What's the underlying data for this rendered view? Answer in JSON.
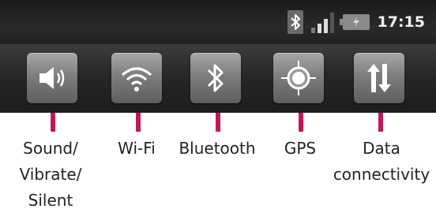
{
  "status_bar": {
    "time": "17:15",
    "icons": [
      "bluetooth-status-icon",
      "signal-strength-icon",
      "battery-icon"
    ]
  },
  "quick_settings": {
    "toggles": [
      {
        "id": "sound",
        "icon": "speaker-icon"
      },
      {
        "id": "wifi",
        "icon": "wifi-icon"
      },
      {
        "id": "bluetooth",
        "icon": "bluetooth-icon"
      },
      {
        "id": "gps",
        "icon": "gps-icon"
      },
      {
        "id": "data",
        "icon": "data-arrows-icon"
      }
    ]
  },
  "labels": {
    "sound": [
      "Sound/",
      "Vibrate/",
      "Silent"
    ],
    "wifi": "Wi-Fi",
    "bluetooth": "Bluetooth",
    "gps": "GPS",
    "data": [
      "Data",
      "connectivity"
    ]
  },
  "colors": {
    "pointer": "#c2185b",
    "status_bar_bg": "#222222",
    "toggle_bg": "#8a8a8a"
  }
}
